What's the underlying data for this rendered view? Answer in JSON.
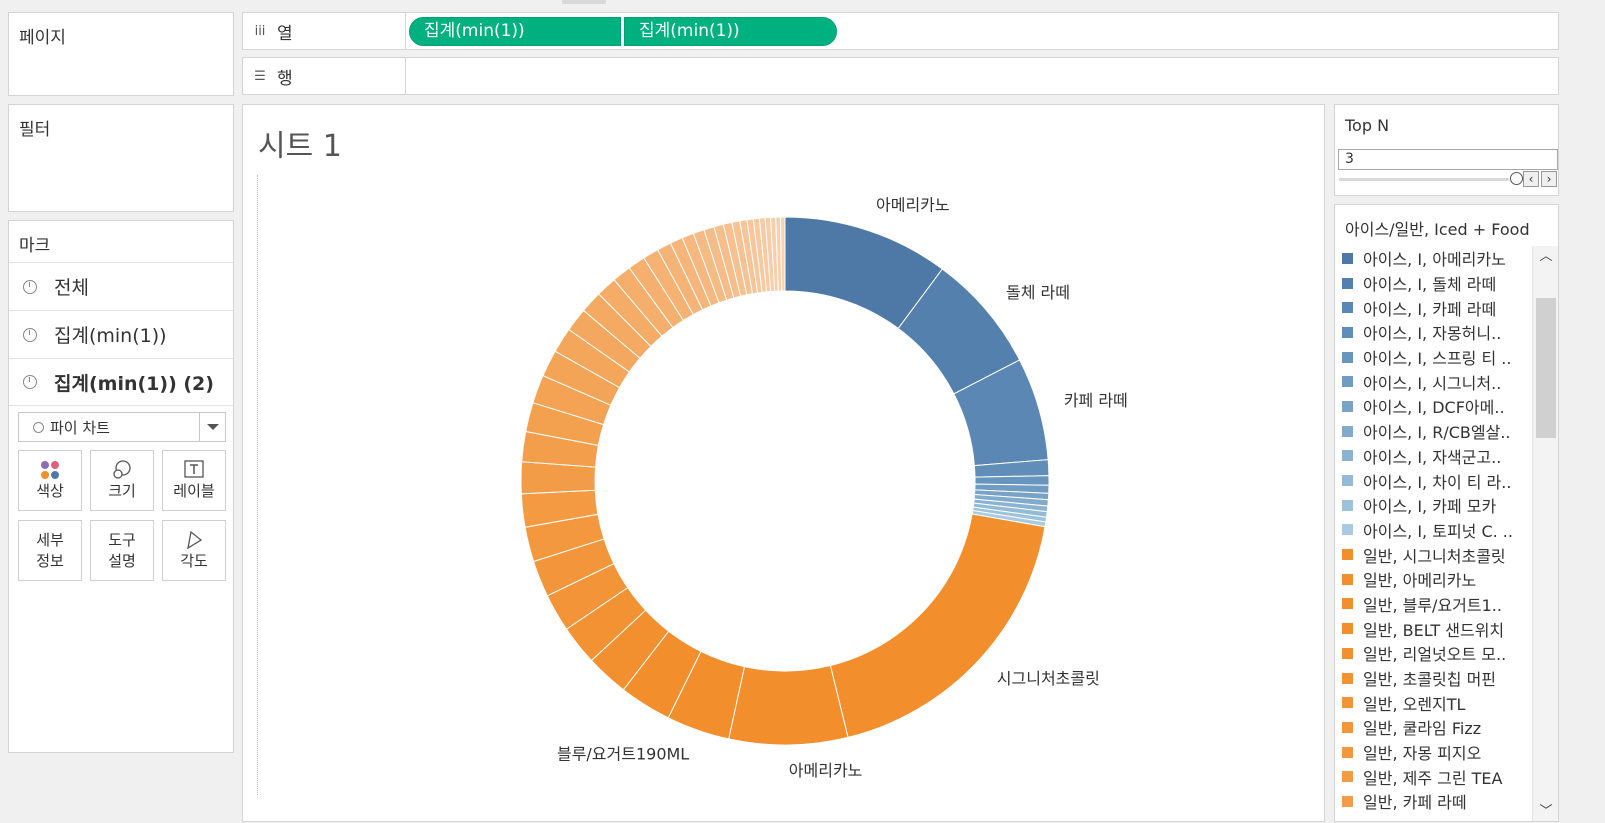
{
  "pages": {
    "title": "페이지"
  },
  "filters": {
    "title": "필터"
  },
  "shelves": {
    "columns": {
      "label": "열",
      "icon": "columns-icon",
      "pills": [
        "집계(min(1))",
        "집계(min(1))"
      ]
    },
    "rows": {
      "label": "행",
      "icon": "rows-icon"
    }
  },
  "marks": {
    "title": "마크",
    "rows": [
      {
        "label": "전체",
        "icon": "pie-icon"
      },
      {
        "label": "집계(min(1))",
        "icon": "pie-icon"
      },
      {
        "label": "집계(min(1)) (2)",
        "icon": "pie-icon"
      }
    ],
    "mark_type": "파이 차트",
    "buttons": [
      {
        "label": "색상",
        "icon": "color-icon"
      },
      {
        "label": "크기",
        "icon": "size-icon"
      },
      {
        "label": "레이블",
        "icon": "label-icon"
      },
      {
        "label": "세부\n정보",
        "icon": "detail-icon"
      },
      {
        "label": "도구\n설명",
        "icon": "tooltip-icon"
      },
      {
        "label": "각도",
        "icon": "angle-icon"
      }
    ]
  },
  "sheet": {
    "title": "시트 1"
  },
  "topn": {
    "title": "Top N",
    "value": "3"
  },
  "legend": {
    "title": "아이스/일반, Iced + Food",
    "items": [
      {
        "label": "아이스, I, 아메리카노",
        "color": "#4e79a7"
      },
      {
        "label": "아이스, I, 돌체 라떼",
        "color": "#5480ad"
      },
      {
        "label": "아이스, I, 카페 라떼",
        "color": "#5a87b3"
      },
      {
        "label": "아이스, I, 자몽허니..",
        "color": "#618eb8"
      },
      {
        "label": "아이스, I, 스프링 티 ..",
        "color": "#6895bd"
      },
      {
        "label": "아이스, I, 시그니처..",
        "color": "#709cc2"
      },
      {
        "label": "아이스, I, DCF아메..",
        "color": "#78a3c7"
      },
      {
        "label": "아이스, I, R/CB엘살..",
        "color": "#81abcc"
      },
      {
        "label": "아이스, I, 자색군고..",
        "color": "#8ab3d1"
      },
      {
        "label": "아이스, I, 차이 티 라..",
        "color": "#93bad6"
      },
      {
        "label": "아이스, I, 카페 모카",
        "color": "#9dc2dc"
      },
      {
        "label": "아이스, I, 토피넛 C. ..",
        "color": "#a8cae2"
      },
      {
        "label": "일반, 시그니처초콜릿",
        "color": "#f28e2b"
      },
      {
        "label": "일반, 아메리카노",
        "color": "#f28e2b"
      },
      {
        "label": "일반, 블루/요거트1..",
        "color": "#f28e2b"
      },
      {
        "label": "일반, BELT 샌드위치",
        "color": "#f28e2b"
      },
      {
        "label": "일반, 리얼넛오트 모..",
        "color": "#f2902f"
      },
      {
        "label": "일반, 초콜릿칩 머핀",
        "color": "#f29233"
      },
      {
        "label": "일반, 오렌지TL",
        "color": "#f29437"
      },
      {
        "label": "일반, 쿨라임 Fizz",
        "color": "#f3963b"
      },
      {
        "label": "일반, 자몽 피지오",
        "color": "#f3983f"
      },
      {
        "label": "일반, 제주 그린 TEA",
        "color": "#f39a43"
      },
      {
        "label": "일반, 카페 라떼",
        "color": "#f39c47"
      }
    ]
  },
  "chart_data": {
    "type": "pie",
    "variant": "donut",
    "segments": [
      {
        "name": "아이스, I, 아메리카노",
        "value": 10.5,
        "label": "아메리카노",
        "color": "#4e79a7"
      },
      {
        "name": "아이스, I, 돌체 라떼",
        "value": 7.5,
        "label": "돌체 라떼",
        "color": "#5480ad"
      },
      {
        "name": "아이스, I, 카페 라떼",
        "value": 6.5,
        "label": "카페 라떼",
        "color": "#5a87b3"
      },
      {
        "name": "아이스, I, 자몽허니..",
        "value": 1.0,
        "color": "#618eb8"
      },
      {
        "name": "아이스, I, 스프링 티 ..",
        "value": 0.6,
        "color": "#6895bd"
      },
      {
        "name": "아이스, I, 시그니처..",
        "value": 0.5,
        "color": "#709cc2"
      },
      {
        "name": "아이스, I, DCF아메..",
        "value": 0.4,
        "color": "#78a3c7"
      },
      {
        "name": "아이스, I, R/CB엘살..",
        "value": 0.4,
        "color": "#81abcc"
      },
      {
        "name": "아이스, I, 자색군고..",
        "value": 0.35,
        "color": "#8ab3d1"
      },
      {
        "name": "아이스, I, 차이 티 라..",
        "value": 0.35,
        "color": "#93bad6"
      },
      {
        "name": "아이스, I, 카페 모카",
        "value": 0.3,
        "color": "#9dc2dc"
      },
      {
        "name": "아이스, I, 토피넛 C. ..",
        "value": 0.3,
        "color": "#a8cae2"
      },
      {
        "name": "일반, 시그니처초콜릿",
        "value": 19.0,
        "label": "시그니처초콜릿",
        "color": "#f28e2b"
      },
      {
        "name": "일반, 아메리카노",
        "value": 7.5,
        "label": "아메리카노",
        "color": "#f28e2b"
      },
      {
        "name": "일반, 블루/요거트1..",
        "value": 4.0,
        "label": "블루/요거트190ML",
        "color": "#f28e2b"
      },
      {
        "name": "일반, BELT 샌드위치",
        "value": 3.3,
        "color": "#f28e2b"
      },
      {
        "name": "일반, 리얼넛오트 모..",
        "value": 2.7,
        "color": "#f2902f"
      },
      {
        "name": "일반, 초콜릿칩 머핀",
        "value": 2.5,
        "color": "#f29233"
      },
      {
        "name": "일반, 오렌지TL",
        "value": 2.4,
        "color": "#f29437"
      },
      {
        "name": "일반, 쿨라임 Fizz",
        "value": 2.3,
        "color": "#f3963b"
      },
      {
        "name": "일반, 자몽 피지오",
        "value": 2.2,
        "color": "#f3983f"
      },
      {
        "name": "일반, 제주 그린 TEA",
        "value": 2.1,
        "color": "#f39a43"
      },
      {
        "name": "일반, 카페 라떼",
        "value": 2.0,
        "color": "#f39c47"
      },
      {
        "value": 1.9,
        "color": "#f39e4b"
      },
      {
        "value": 1.85,
        "color": "#f3a04f"
      },
      {
        "value": 1.8,
        "color": "#f4a253"
      },
      {
        "value": 1.7,
        "color": "#f4a457"
      },
      {
        "value": 1.6,
        "color": "#f4a65b"
      },
      {
        "value": 1.5,
        "color": "#f4a85f"
      },
      {
        "value": 1.4,
        "color": "#f4aa63"
      },
      {
        "value": 1.3,
        "color": "#f5ac67"
      },
      {
        "value": 1.2,
        "color": "#f5ae6b"
      },
      {
        "value": 1.1,
        "color": "#f5b06f"
      },
      {
        "value": 1.0,
        "color": "#f5b273"
      },
      {
        "value": 0.9,
        "color": "#f5b477"
      },
      {
        "value": 0.8,
        "color": "#f6b67b"
      },
      {
        "value": 0.75,
        "color": "#f6b87f"
      },
      {
        "value": 0.7,
        "color": "#f6ba83"
      },
      {
        "value": 0.65,
        "color": "#f6bc87"
      },
      {
        "value": 0.6,
        "color": "#f6be8b"
      },
      {
        "value": 0.55,
        "color": "#f7c08f"
      },
      {
        "value": 0.5,
        "color": "#f7c293"
      },
      {
        "value": 0.45,
        "color": "#f7c497"
      },
      {
        "value": 0.4,
        "color": "#f7c69b"
      },
      {
        "value": 0.38,
        "color": "#f8c89f"
      },
      {
        "value": 0.36,
        "color": "#f8caa3"
      },
      {
        "value": 0.34,
        "color": "#f8cca7"
      },
      {
        "value": 0.32,
        "color": "#f8ceab"
      },
      {
        "value": 0.3,
        "color": "#f8d0af"
      },
      {
        "value": 0.28,
        "color": "#f9d2b3"
      }
    ]
  }
}
